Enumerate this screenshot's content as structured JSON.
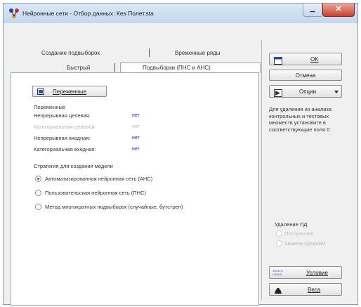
{
  "window": {
    "title": "Нейронные сети - Отбор данных: Кеs Полет.sta",
    "close_glyph": "✕",
    "minimize_glyph": "▁"
  },
  "tabs": {
    "row1": [
      "Создание подвыборок",
      "Временные ряды"
    ],
    "row2": [
      "Быстрый",
      "Подвыборки (ПНС и АНС)"
    ]
  },
  "panel": {
    "variables_button": "Переменные",
    "variables_heading": "Переменные",
    "variable_rows": [
      {
        "label": "Непрерывная целевая:",
        "value": "нет",
        "disabled": false
      },
      {
        "label": "Категориальная целевая:",
        "value": "нет",
        "disabled": true
      },
      {
        "label": "Непрерывная входная:",
        "value": "нет",
        "disabled": false
      },
      {
        "label": "Категориальная входная:",
        "value": "нет",
        "disabled": false
      }
    ],
    "strategy_heading": "Стратегия для создания модели",
    "strategies": [
      {
        "label": "Автоматизированная нейронная сеть (АНС)",
        "checked": true
      },
      {
        "label": "Пользовательская нейронная сеть (ПНС)",
        "checked": false
      },
      {
        "label": "Метод многократных подвыборок (случайные, бутстреп)",
        "checked": false
      }
    ]
  },
  "right": {
    "ok_label": "OK",
    "cancel_label": "Отмена",
    "options_label": "Опции",
    "note": "Для удаления из анализа контрольных и тестовых множеств установите в соответствующие поля 0",
    "md_heading": "Удаление ПД",
    "md_options": [
      "Построчное",
      "Замена средним"
    ],
    "condition_label": "Условие",
    "weights_label": "Веса",
    "select_cases_icon_text": "SELECT CASES"
  },
  "colors": {
    "accent": "#1a5fb4",
    "value_blue": "#1a2fd8",
    "close_red": "#c8402e"
  }
}
